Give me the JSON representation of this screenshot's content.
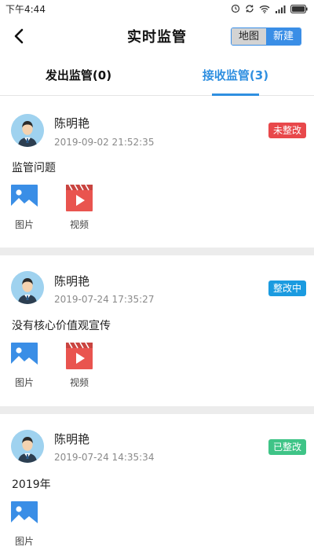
{
  "status_bar": {
    "time": "下午4:44"
  },
  "header": {
    "title": "实时监管",
    "segment": {
      "map": "地图",
      "new": "新建"
    }
  },
  "tabs": [
    {
      "label": "发出监管(0)"
    },
    {
      "label": "接收监管(3)"
    }
  ],
  "colors": {
    "accent": "#2f8fe0",
    "badge_pending": "#e8484b",
    "badge_in_progress": "#1b9be0",
    "badge_done": "#3fc487"
  },
  "records": [
    {
      "name": "陈明艳",
      "time": "2019-09-02 21:52:35",
      "status": "未整改",
      "content": "监管问题",
      "attachments": [
        {
          "icon": "image-icon",
          "label": "图片"
        },
        {
          "icon": "video-icon",
          "label": "视频"
        }
      ]
    },
    {
      "name": "陈明艳",
      "time": "2019-07-24 17:35:27",
      "status": "整改中",
      "content": "没有核心价值观宣传",
      "attachments": [
        {
          "icon": "image-icon",
          "label": "图片"
        },
        {
          "icon": "video-icon",
          "label": "视频"
        }
      ]
    },
    {
      "name": "陈明艳",
      "time": "2019-07-24 14:35:34",
      "status": "已整改",
      "content": "2019年",
      "attachments": [
        {
          "icon": "image-icon",
          "label": "图片"
        }
      ]
    }
  ]
}
